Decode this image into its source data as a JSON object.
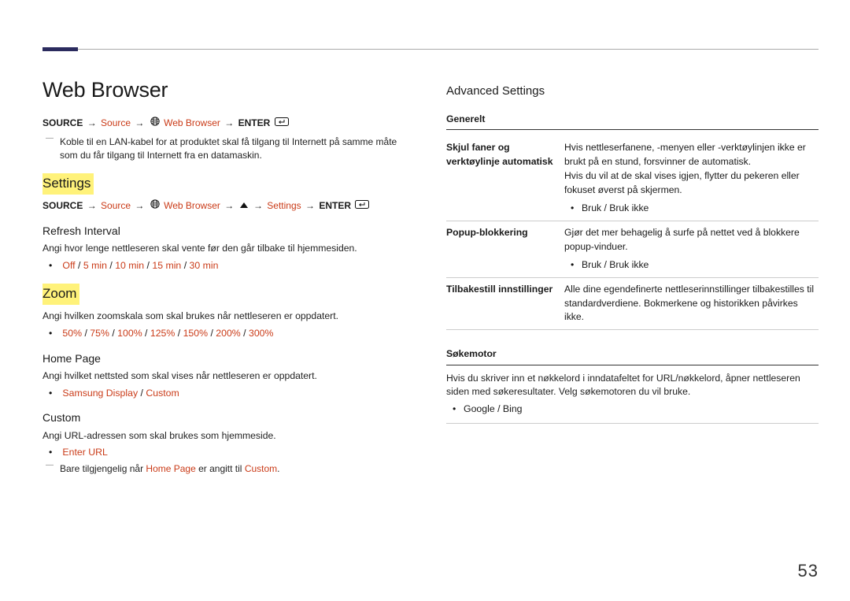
{
  "page_number": "53",
  "left": {
    "title": "Web Browser",
    "nav1": {
      "source_label": "SOURCE",
      "source_accent": "Source",
      "web_accent": "Web Browser",
      "enter": "ENTER"
    },
    "nav1_note": "Koble til en LAN-kabel for at produktet skal få tilgang til Internett på samme måte som du får tilgang til Internett fra en datamaskin.",
    "settings_heading": "Settings",
    "nav2": {
      "source_label": "SOURCE",
      "source_accent": "Source",
      "web_accent": "Web Browser",
      "settings_accent": "Settings",
      "enter": "ENTER"
    },
    "refresh": {
      "heading": "Refresh Interval",
      "text": "Angi hvor lenge nettleseren skal vente før den går tilbake til hjemmesiden.",
      "options": [
        "Off",
        "5 min",
        "10 min",
        "15 min",
        "30 min"
      ]
    },
    "zoom": {
      "heading": "Zoom",
      "text": "Angi hvilken zoomskala som skal brukes når nettleseren er oppdatert.",
      "options": [
        "50%",
        "75%",
        "100%",
        "125%",
        "150%",
        "200%",
        "300%"
      ]
    },
    "home": {
      "heading": "Home Page",
      "text": "Angi hvilket nettsted som skal vises når nettleseren er oppdatert.",
      "options": [
        "Samsung Display",
        "Custom"
      ]
    },
    "custom": {
      "heading": "Custom",
      "text": "Angi URL-adressen som skal brukes som hjemmeside.",
      "option": "Enter URL",
      "note_pre": "Bare tilgjengelig når ",
      "note_hp": "Home Page",
      "note_mid": " er angitt til ",
      "note_custom": "Custom",
      "note_post": "."
    }
  },
  "right": {
    "adv_heading": "Advanced Settings",
    "generelt_label": "Generelt",
    "rows": [
      {
        "k": "Skjul faner og verktøylinje automatisk",
        "v1": "Hvis nettleserfanene, -menyen eller -verktøylinjen ikke er brukt på en stund, forsvinner de automatisk.",
        "v2": "Hvis du vil at de skal vises igjen, flytter du pekeren eller fokuset øverst på skjermen.",
        "opts": [
          "Bruk / Bruk ikke"
        ]
      },
      {
        "k": "Popup-blokkering",
        "v1": "Gjør det mer behagelig å surfe på nettet ved å blokkere popup-vinduer.",
        "opts": [
          "Bruk / Bruk ikke"
        ]
      },
      {
        "k": "Tilbakestill innstillinger",
        "v1": "Alle dine egendefinerte nettleserinnstillinger tilbakestilles til standardverdiene. Bokmerkene og historikken påvirkes ikke."
      }
    ],
    "sokemotor_label": "Søkemotor",
    "sokemotor_text": "Hvis du skriver inn et nøkkelord i inndatafeltet for URL/nøkkelord, åpner nettleseren siden med søkeresultater. Velg søkemotoren du vil bruke.",
    "sokemotor_opts": [
      "Google / Bing"
    ]
  }
}
